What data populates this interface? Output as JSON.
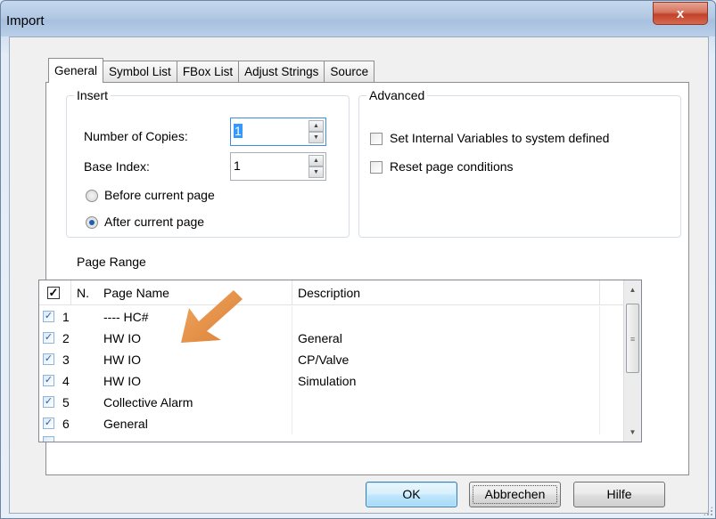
{
  "window": {
    "title": "Import",
    "close_glyph": "x"
  },
  "tabs": [
    {
      "label": "General",
      "active": true
    },
    {
      "label": "Symbol List",
      "active": false
    },
    {
      "label": "FBox List",
      "active": false
    },
    {
      "label": "Adjust Strings",
      "active": false
    },
    {
      "label": "Source",
      "active": false
    }
  ],
  "insert": {
    "legend": "Insert",
    "copies_label": "Number of Copies:",
    "copies_value": "1",
    "base_index_label": "Base Index:",
    "base_index_value": "1",
    "before_label": "Before current page",
    "after_label": "After current page",
    "selected_position": "after"
  },
  "advanced": {
    "legend": "Advanced",
    "set_internal_label": "Set Internal Variables to system defined",
    "set_internal_checked": false,
    "reset_page_label": "Reset page conditions",
    "reset_page_checked": false
  },
  "page_range": {
    "label": "Page Range",
    "columns": [
      "N.",
      "Page Name",
      "Description"
    ],
    "header_checked": true,
    "rows": [
      {
        "n": "1",
        "name": "---- HC#",
        "description": "",
        "checked": true
      },
      {
        "n": "2",
        "name": "HW IO",
        "description": "General",
        "checked": true
      },
      {
        "n": "3",
        "name": "HW IO",
        "description": "CP/Valve",
        "checked": true
      },
      {
        "n": "4",
        "name": "HW IO",
        "description": "Simulation",
        "checked": true
      },
      {
        "n": "5",
        "name": "Collective Alarm",
        "description": "",
        "checked": true
      },
      {
        "n": "6",
        "name": "General",
        "description": "",
        "checked": true
      }
    ]
  },
  "buttons": {
    "ok": "OK",
    "cancel": "Abbrechen",
    "help": "Hilfe"
  },
  "colors": {
    "annotation_arrow": "#e08a3c",
    "accent": "#3c7fb1"
  }
}
